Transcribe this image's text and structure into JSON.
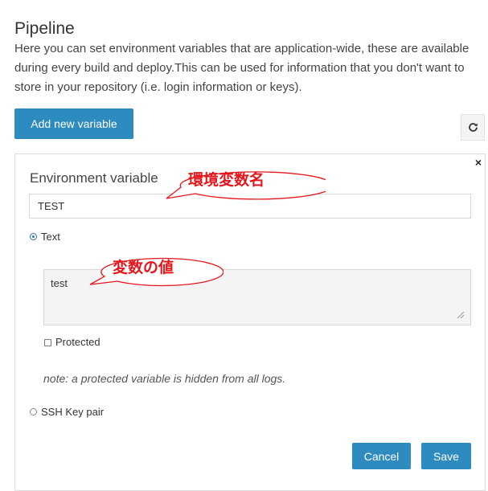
{
  "header": {
    "title": "Pipeline",
    "description": "Here you can set environment variables that are application-wide, these are available during every build and deploy.This can be used for information that you don't want to store in your repository (i.e. login information or keys)."
  },
  "toolbar": {
    "add_label": "Add new variable",
    "refresh_icon": "refresh-icon"
  },
  "form": {
    "close_label": "×",
    "field_label": "Environment variable",
    "name_value": "TEST",
    "type_options": [
      {
        "label": "Text",
        "checked": true
      },
      {
        "label": "SSH Key pair",
        "checked": false
      }
    ],
    "text_value": "test",
    "protected_label": "Protected",
    "protected_checked": false,
    "note": "note: a protected variable is hidden from all logs.",
    "cancel_label": "Cancel",
    "save_label": "Save"
  },
  "annotations": {
    "name_callout": "環境変数名",
    "value_callout": "変数の値"
  },
  "colors": {
    "primary": "#2e8bc0",
    "callout": "#e4161b"
  }
}
